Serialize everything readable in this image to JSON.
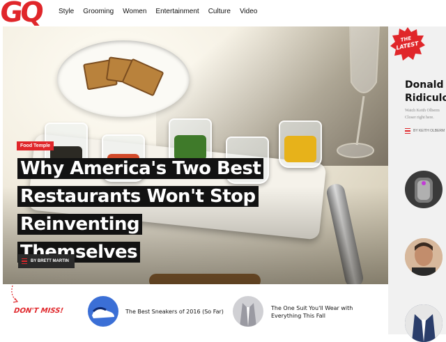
{
  "brand": {
    "logo_text": "GQ",
    "accent_color": "#e0262a"
  },
  "nav": {
    "items": [
      "Style",
      "Grooming",
      "Women",
      "Entertainment",
      "Culture",
      "Video"
    ]
  },
  "hero": {
    "category": "Food Temple",
    "headline_lines": [
      "Why America's Two Best",
      "Restaurants Won't Stop Reinventing",
      "Themselves"
    ],
    "byline": "BY BRETT MARTIN"
  },
  "latest": {
    "badge_line1": "THE",
    "badge_line2": "LATEST",
    "title_line1": "Donald Tr",
    "title_line2": "Ridiculou",
    "desc_line1": "Watch Keith Olberm",
    "desc_line2": "Closer right here.",
    "byline": "BY KEITH OLBERM"
  },
  "dont_miss": {
    "label": "DON'T MISS!",
    "items": [
      {
        "title_line1": "The Best Sneakers of 2016 (So Far)",
        "title_line2": "",
        "icon": "sneaker-icon"
      },
      {
        "title_line1": "The One Suit You'll Wear with",
        "title_line2": "Everything This Fall",
        "icon": "suit-icon"
      }
    ]
  }
}
